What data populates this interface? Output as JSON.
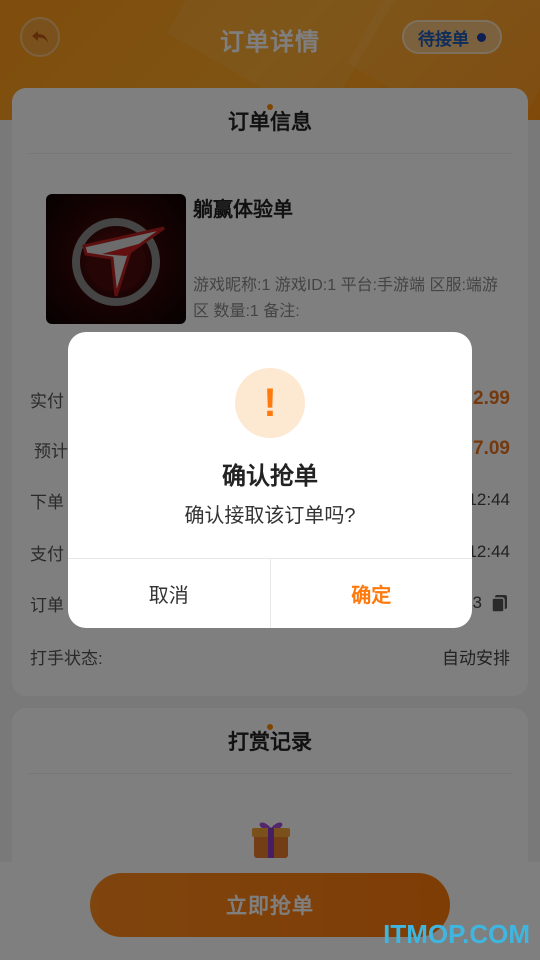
{
  "header": {
    "title": "订单详情",
    "status": "待接单"
  },
  "order_card": {
    "heading": "订单信息",
    "item_name": "躺赢体验单",
    "item_desc": "游戏昵称:1 游戏ID:1 平台:手游端 区服:端游区 数量:1 备注:"
  },
  "rows": [
    {
      "label": "实付",
      "value": "2.99"
    },
    {
      "label": "预计",
      "value": "7.09"
    },
    {
      "label": "下单",
      "value": "12:44"
    },
    {
      "label": "支付",
      "value": "12:44"
    },
    {
      "label": "订单",
      "value": "3"
    },
    {
      "label": "打手状态:",
      "value": "自动安排"
    }
  ],
  "reward_card": {
    "heading": "打赏记录"
  },
  "bottom": {
    "grab_label": "立即抢单"
  },
  "dialog": {
    "title": "确认抢单",
    "message": "确认接取该订单吗?",
    "cancel": "取消",
    "confirm": "确定",
    "icon": "warning-icon"
  },
  "watermark": "ITMOP.COM",
  "colors": {
    "accent": "#ff8a1c",
    "status_text": "#1e5ab4"
  }
}
